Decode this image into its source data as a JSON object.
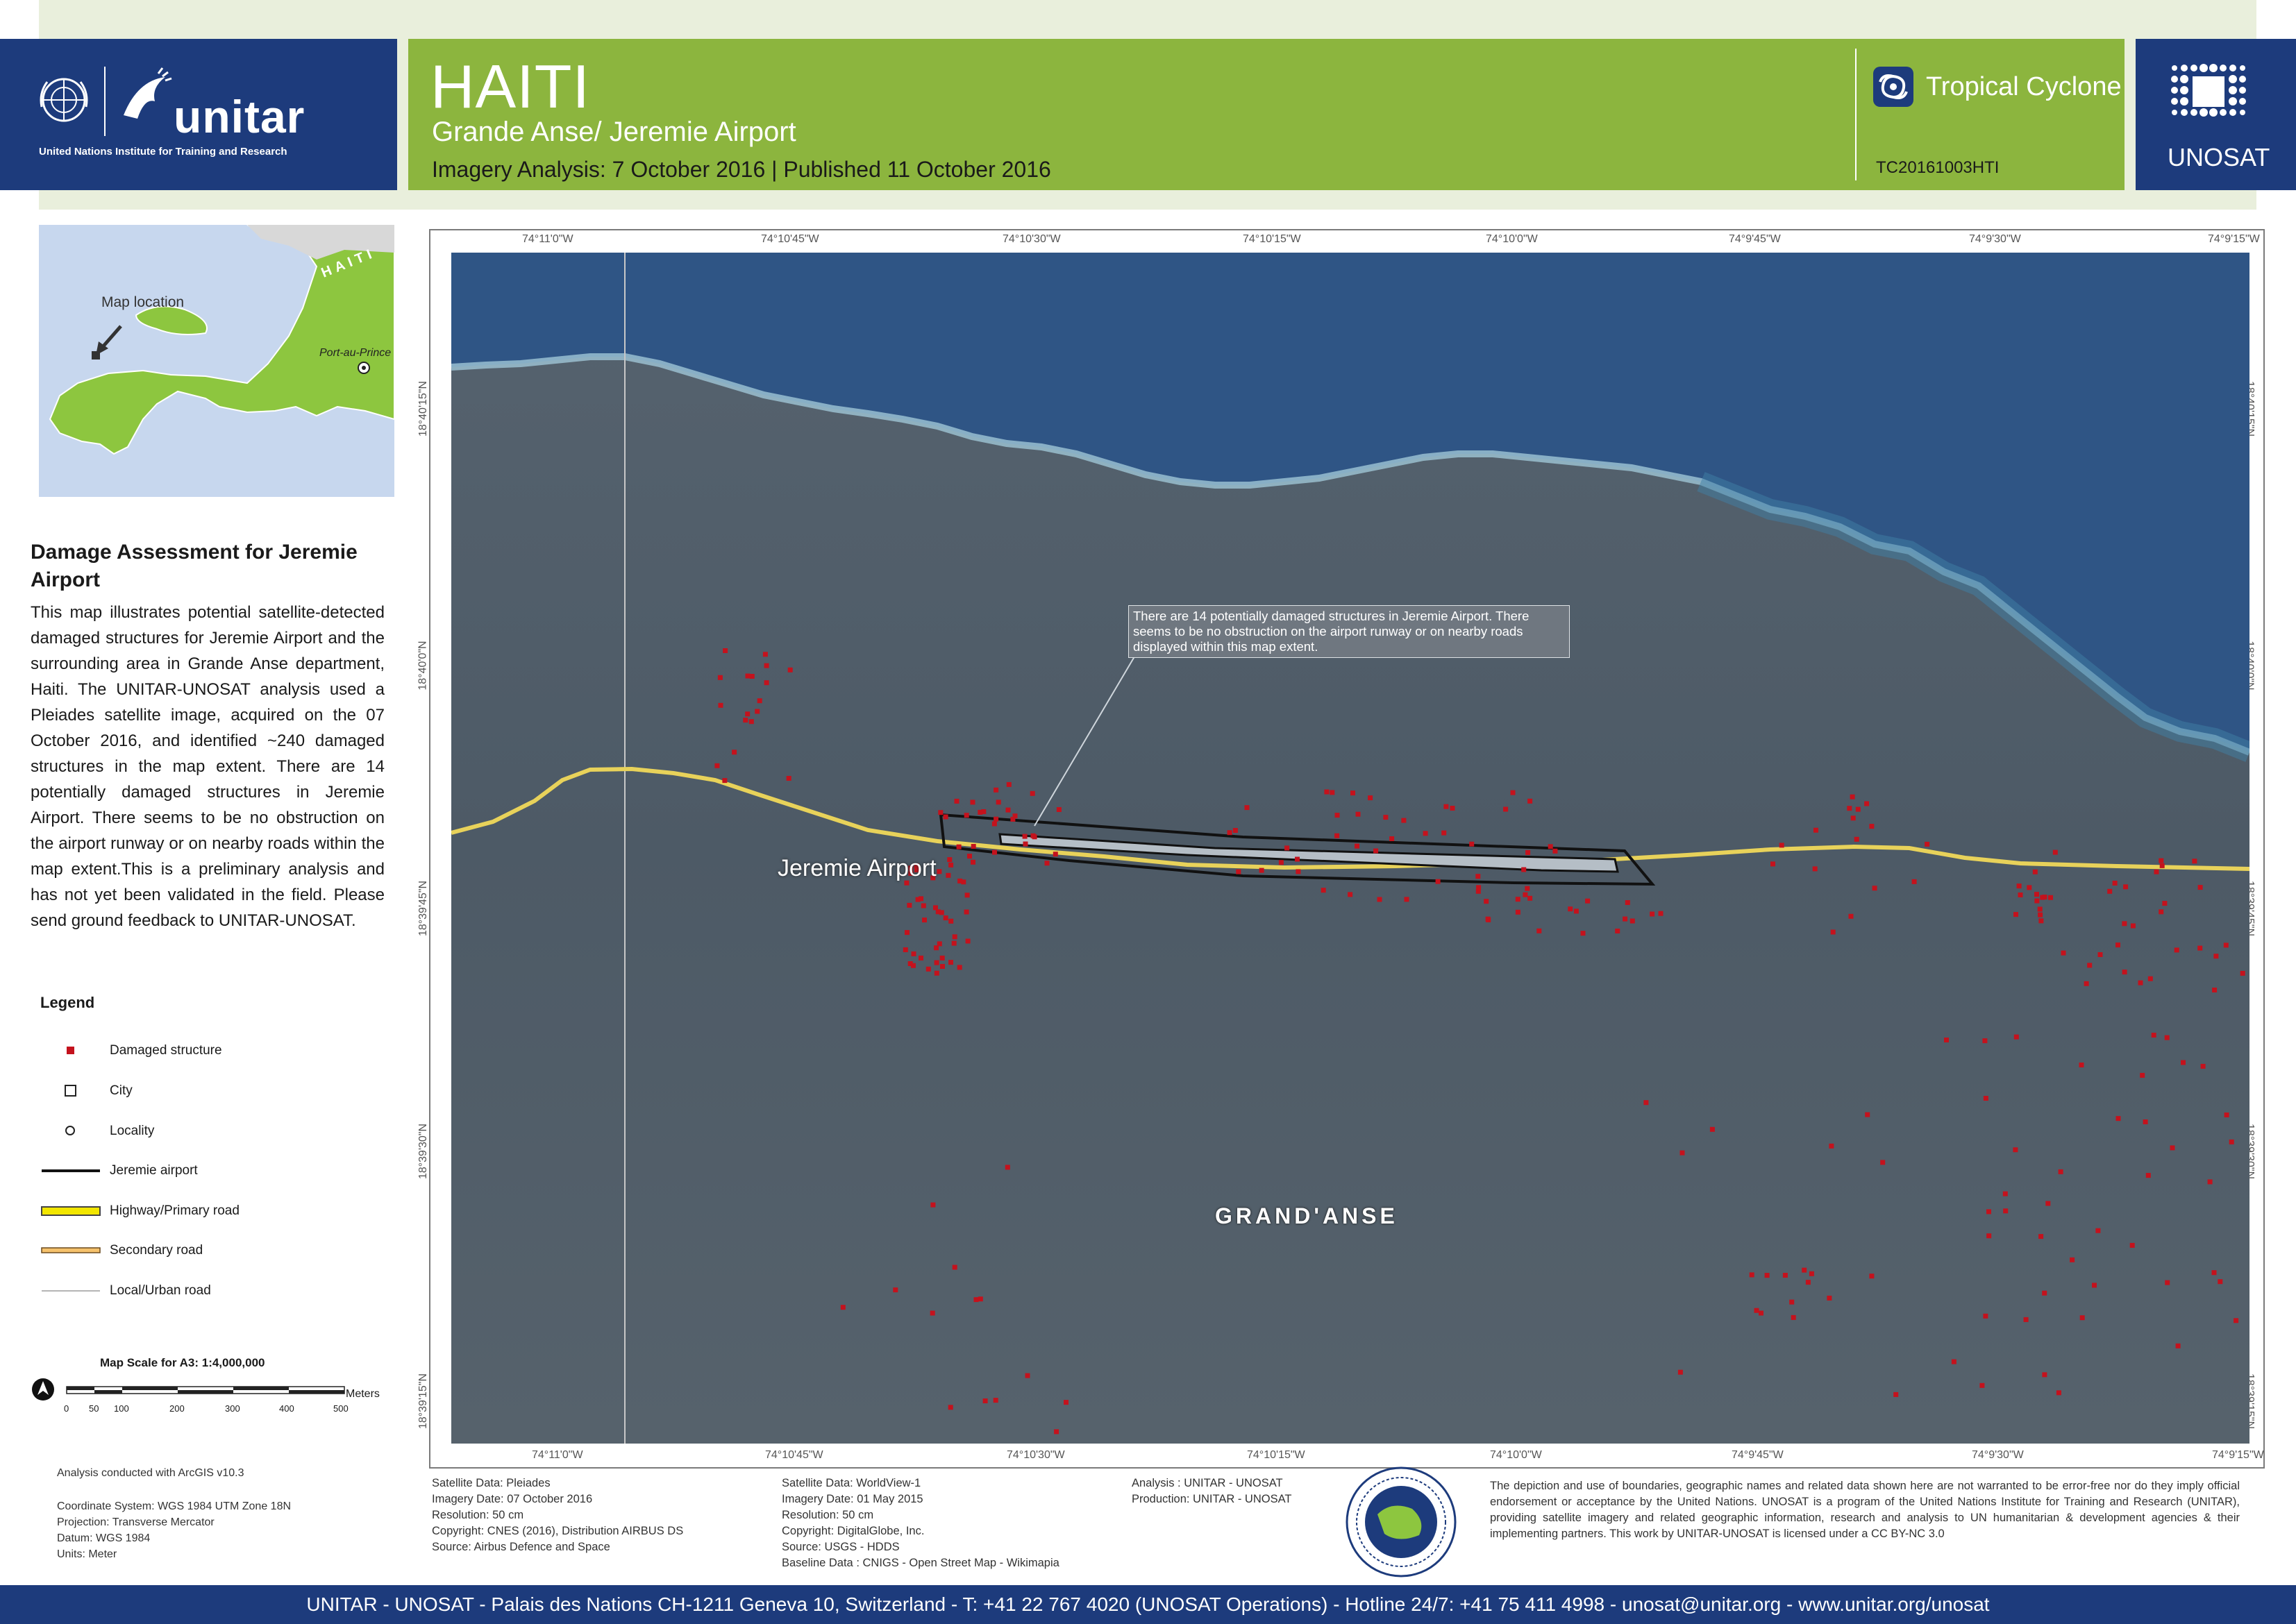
{
  "header": {
    "org_name": "unitar",
    "org_subtitle": "United Nations Institute for Training and Research",
    "title": "HAITI",
    "subtitle": "Grande Anse/ Jeremie Airport",
    "imagery_line": "Imagery Analysis: 7 October 2016  | Published 11 October 2016",
    "hazard": "Tropical Cyclone",
    "glide": "TC20161003HTI",
    "unosat": "UNOSAT"
  },
  "inset": {
    "country_label": "HAITI",
    "map_location_label": "Map location",
    "capital_label": "Port-au-Prince"
  },
  "panel": {
    "title": "Damage Assessment for Jeremie Airport",
    "body": "This map illustrates potential satellite-detected damaged structures for Jeremie Airport and the surrounding area in Grande Anse department, Haiti. The UNITAR-UNOSAT analysis used a Pleiades satellite image, acquired on the 07 October 2016, and identified ~240 damaged structures in the map extent. There are 14 potentially damaged structures in Jeremie Airport. There seems to be no obstruction on the airport runway or on nearby roads within the map extent.This is a preliminary analysis and has not yet been validated in the field. Please send ground feedback to UNITAR-UNOSAT."
  },
  "legend": {
    "title": "Legend",
    "items": [
      {
        "label": "Damaged structure",
        "icon": "red-square"
      },
      {
        "label": "City",
        "icon": "hollow-square"
      },
      {
        "label": "Locality",
        "icon": "hollow-circle"
      },
      {
        "label": "Jeremie airport",
        "icon": "black-line"
      },
      {
        "label": "Highway/Primary road",
        "icon": "yellow-line"
      },
      {
        "label": "Secondary road",
        "icon": "orange-line"
      },
      {
        "label": "Local/Urban road",
        "icon": "grey-line"
      }
    ]
  },
  "scale": {
    "title": "Map Scale for A3: 1:4,000,000",
    "unit": "Meters",
    "ticks": [
      "0",
      "50",
      "100",
      "200",
      "300",
      "400",
      "500"
    ]
  },
  "meta": {
    "software": "Analysis conducted with ArcGIS v10.3",
    "coordinate_lines": [
      "Coordinate System: WGS 1984 UTM Zone 18N",
      "Projection: Transverse Mercator",
      "Datum: WGS 1984",
      "Units: Meter"
    ]
  },
  "map": {
    "top_ticks": [
      "74°11'0\"W",
      "74°10'45\"W",
      "74°10'30\"W",
      "74°10'15\"W",
      "74°10'0\"W",
      "74°9'45\"W",
      "74°9'30\"W",
      "74°9'15\"W"
    ],
    "side_ticks": [
      "18°40'15\"N",
      "18°40'0\"N",
      "18°39'45\"N",
      "18°39'30\"N",
      "18°39'15\"N"
    ],
    "airport_label": "Jeremie Airport",
    "region_label": "GRAND'ANSE",
    "callout": "There are 14 potentially damaged structures in Jeremie Airport. There seems to be no obstruction on the airport runway or on nearby roads displayed within this map extent.",
    "colors": {
      "sea": "#2f5585",
      "land": "#4a5a6a",
      "damage": "#c4121d",
      "road": "#e8d25a"
    }
  },
  "sources": {
    "col1": [
      "Satellite Data: Pleiades",
      "Imagery Date: 07 October 2016",
      "Resolution: 50 cm",
      "Copyright: CNES (2016), Distribution AIRBUS DS",
      "Source: Airbus Defence and Space"
    ],
    "col2": [
      "Satellite Data: WorldView-1",
      "Imagery Date: 01 May 2015",
      "Resolution: 50 cm",
      "Copyright: DigitalGlobe, Inc.",
      "Source: USGS - HDDS",
      "Baseline Data : CNIGS - Open Street Map - Wikimapia"
    ],
    "col3": [
      "Analysis : UNITAR - UNOSAT",
      "Production: UNITAR - UNOSAT"
    ],
    "disclaimer": "The depiction and use of boundaries, geographic names and related data shown here are not warranted to be error-free nor do they imply official endorsement or acceptance by the United Nations. UNOSAT is a program of the United Nations Institute for Training and Research (UNITAR), providing satellite imagery and related geographic information, research and analysis to UN humanitarian & development agencies & their implementing partners. This work by UNITAR-UNOSAT is licensed under a CC BY-NC 3.0"
  },
  "footer": {
    "text": "UNITAR - UNOSAT - Palais des Nations CH-1211 Geneva 10, Switzerland - T: +41 22 767 4020 (UNOSAT Operations) - Hotline 24/7: +41 75 411 4998 - unosat@unitar.org - www.unitar.org/unosat"
  }
}
